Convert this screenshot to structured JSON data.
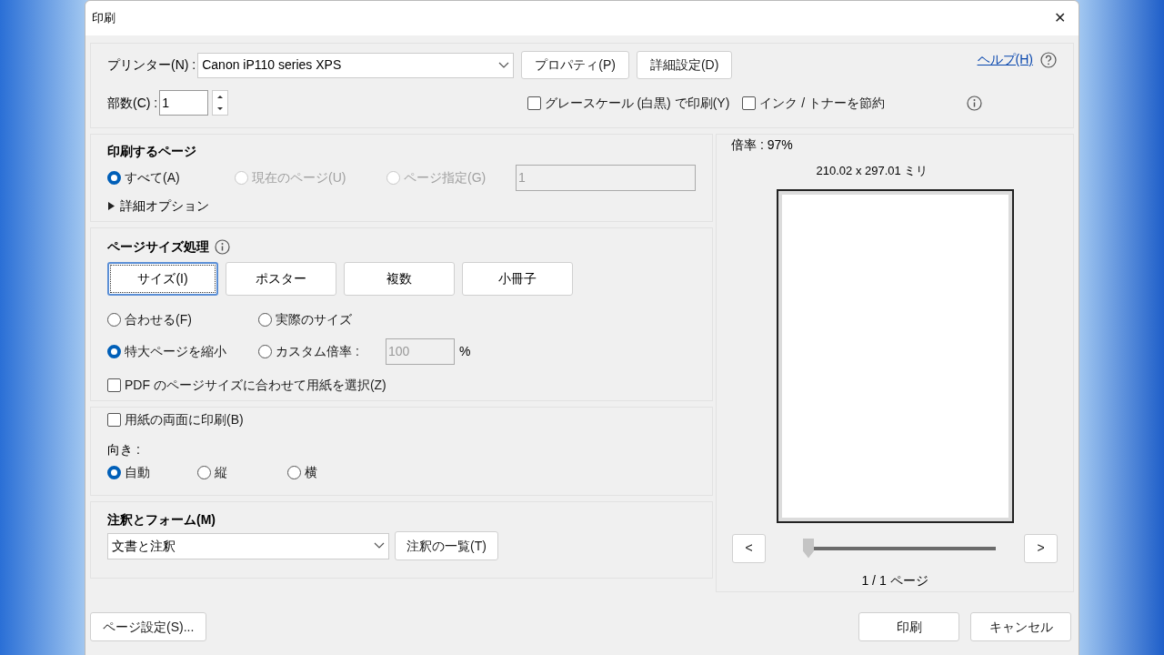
{
  "window": {
    "title": "印刷",
    "close": "✕"
  },
  "printer": {
    "label": "プリンター(N) :",
    "value": "Canon iP110 series XPS",
    "buttons": [
      "プロパティ(P)",
      "詳細設定(D)"
    ],
    "help": "ヘルプ(H)"
  },
  "copies": {
    "label": "部数(C) :",
    "value": "1"
  },
  "print_options": [
    {
      "label": "グレースケール (白黒) で印刷(Y)",
      "checked": false
    },
    {
      "label": "インク / トナーを節約",
      "checked": false
    }
  ],
  "pages": {
    "title": "印刷するページ",
    "options": [
      {
        "label": "すべて(A)",
        "selected": true,
        "disabled": false
      },
      {
        "label": "現在のページ(U)",
        "selected": false,
        "disabled": true
      },
      {
        "label": "ページ指定(G)",
        "selected": false,
        "disabled": true
      }
    ],
    "range_value": "1",
    "more": {
      "label": "詳細オプション",
      "expanded": false
    }
  },
  "page_sizing": {
    "title": "ページサイズ処理",
    "modes": [
      {
        "label": "サイズ(I)",
        "selected": true
      },
      {
        "label": "ポスター",
        "selected": false
      },
      {
        "label": "複数",
        "selected": false
      },
      {
        "label": "小冊子",
        "selected": false
      }
    ],
    "options": [
      {
        "label": "合わせる(F)",
        "selected": false
      },
      {
        "label": "実際のサイズ",
        "selected": false
      },
      {
        "label": "特大ページを縮小",
        "selected": true
      },
      {
        "label": "カスタム倍率 :",
        "selected": false
      }
    ],
    "custom_scale": "100",
    "percent": "%",
    "choose_paper": {
      "label": "PDF のページサイズに合わせて用紙を選択(Z)",
      "checked": false
    }
  },
  "duplex": {
    "label": "用紙の両面に印刷(B)",
    "checked": false,
    "orientation_label": "向き :",
    "orientations": [
      {
        "label": "自動",
        "selected": true
      },
      {
        "label": "縦",
        "selected": false
      },
      {
        "label": "横",
        "selected": false
      }
    ]
  },
  "annotations": {
    "title": "注釈とフォーム(M)",
    "value": "文書と注釈",
    "button": "注釈の一覧(T)"
  },
  "preview": {
    "scale": "倍率 : 97%",
    "size": "210.02 x 297.01 ミリ",
    "prev": "<",
    "next": ">",
    "slider": {
      "level": 0
    },
    "page": "1 / 1 ページ"
  },
  "footer": {
    "page_setup": "ページ設定(S)...",
    "print": "印刷",
    "cancel": "キャンセル"
  }
}
